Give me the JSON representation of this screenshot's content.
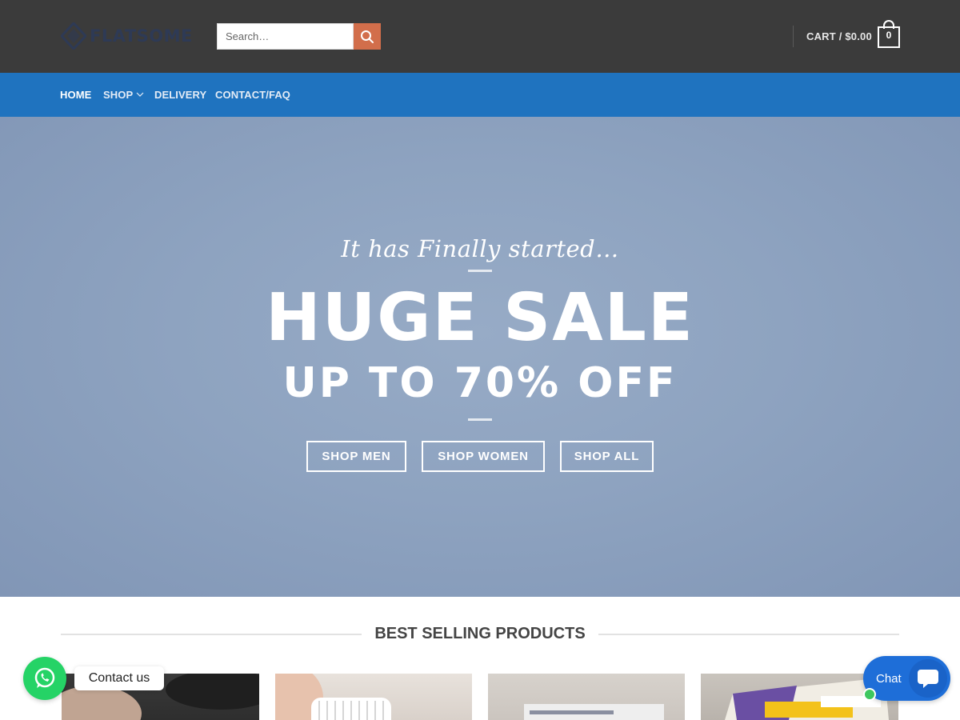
{
  "header": {
    "logo_text": "FLATSOME",
    "search_placeholder": "Search…",
    "cart_label": "CART / $0.00",
    "cart_count": "0"
  },
  "nav": {
    "items": [
      {
        "label": "HOME",
        "active": true
      },
      {
        "label": "SHOP",
        "has_dropdown": true
      },
      {
        "label": "DELIVERY"
      },
      {
        "label": "CONTACT/FAQ"
      }
    ]
  },
  "hero": {
    "tagline": "It has Finally started…",
    "title": "HUGE SALE",
    "subtitle": "UP TO 70% OFF",
    "buttons": [
      "SHOP MEN",
      "SHOP WOMEN",
      "SHOP ALL"
    ]
  },
  "section": {
    "title": "BEST SELLING PRODUCTS"
  },
  "widgets": {
    "contact_label": "Contact us",
    "chat_label": "Chat"
  },
  "colors": {
    "header_bg": "#3b3b3b",
    "nav_bg": "#1f73bf",
    "search_button": "#d26e4b",
    "whatsapp": "#25d366",
    "chat": "#1e6ed8"
  }
}
